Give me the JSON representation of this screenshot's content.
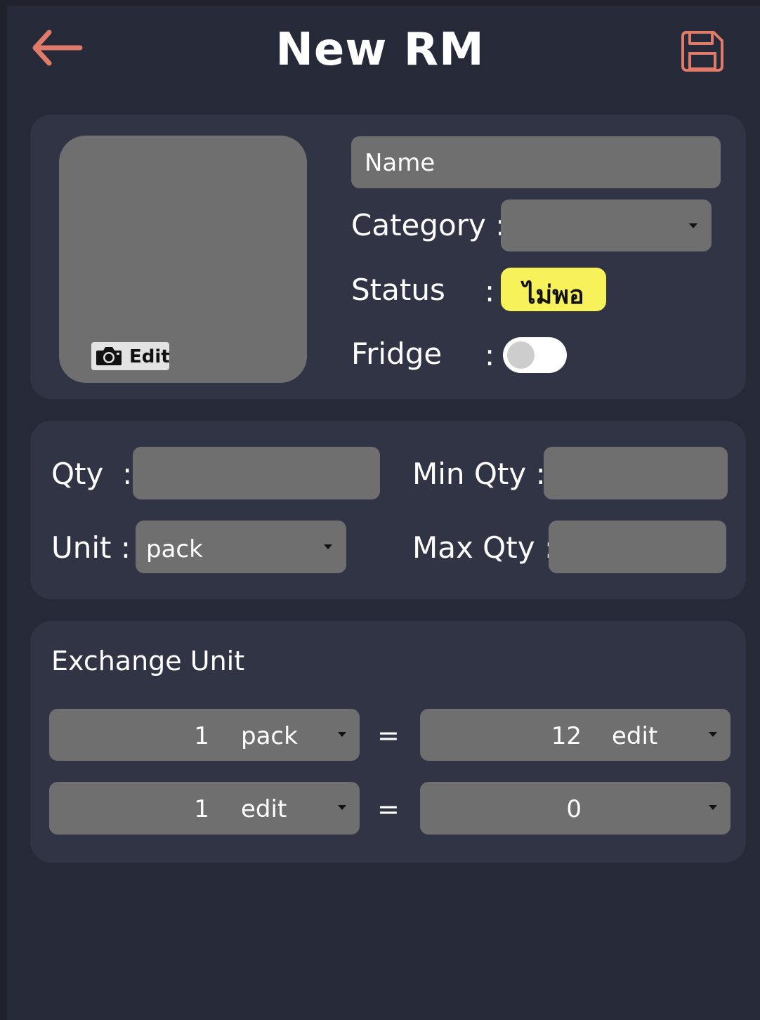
{
  "header": {
    "title": "New RM",
    "back_icon": "arrow-left-icon",
    "save_icon": "floppy-disk-icon",
    "accent_color": "#e07b6a"
  },
  "photo": {
    "edit_label": "Edit",
    "camera_icon": "camera-icon"
  },
  "info": {
    "name_placeholder": "Name",
    "category_label": "Category :",
    "category_value": "",
    "status_label": "Status",
    "status_colon": ":",
    "status_value": "ไม่พอ",
    "status_color": "#f8f25a",
    "fridge_label": "Fridge",
    "fridge_colon": ":",
    "fridge_on": false
  },
  "quantities": {
    "qty_label": "Qty  :",
    "qty_value": "",
    "min_qty_label": "Min Qty :",
    "min_qty_value": "",
    "unit_label": "Unit :",
    "unit_value": "pack",
    "max_qty_label": "Max Qty :",
    "max_qty_value": ""
  },
  "exchange": {
    "title": "Exchange Unit",
    "equals": "=",
    "rows": [
      {
        "left_qty": "1",
        "left_unit": "pack",
        "right_qty": "12",
        "right_unit": "edit"
      },
      {
        "left_qty": "1",
        "left_unit": "edit",
        "right_qty": "0",
        "right_unit": ""
      }
    ]
  }
}
